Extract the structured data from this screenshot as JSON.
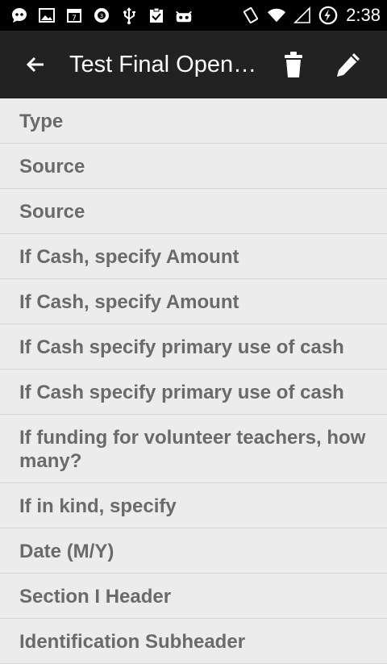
{
  "status_bar": {
    "time": "2:38",
    "left_icons": [
      "chat-icon",
      "image-icon",
      "calendar-icon",
      "settings-badge-icon",
      "usb-icon",
      "clipboard-check-icon",
      "android-icon"
    ],
    "right_icons": [
      "rotate-icon",
      "wifi-icon",
      "signal-icon",
      "battery-charging-icon"
    ]
  },
  "app_bar": {
    "title": "Test Final Open…"
  },
  "fields": [
    {
      "label": "Type"
    },
    {
      "label": "Source"
    },
    {
      "label": "Source"
    },
    {
      "label": "If Cash, specify Amount"
    },
    {
      "label": "If Cash, specify Amount"
    },
    {
      "label": "If Cash specify primary use of cash"
    },
    {
      "label": "If Cash specify primary use of cash"
    },
    {
      "label": "If funding for volunteer teachers, how many?"
    },
    {
      "label": "If in kind, specify"
    },
    {
      "label": "Date (M/Y)"
    },
    {
      "label": "Section I Header"
    },
    {
      "label": "Identification Subheader"
    }
  ],
  "colors": {
    "appbar": "#222222",
    "background": "#ececec",
    "text": "#6a6a6a"
  }
}
